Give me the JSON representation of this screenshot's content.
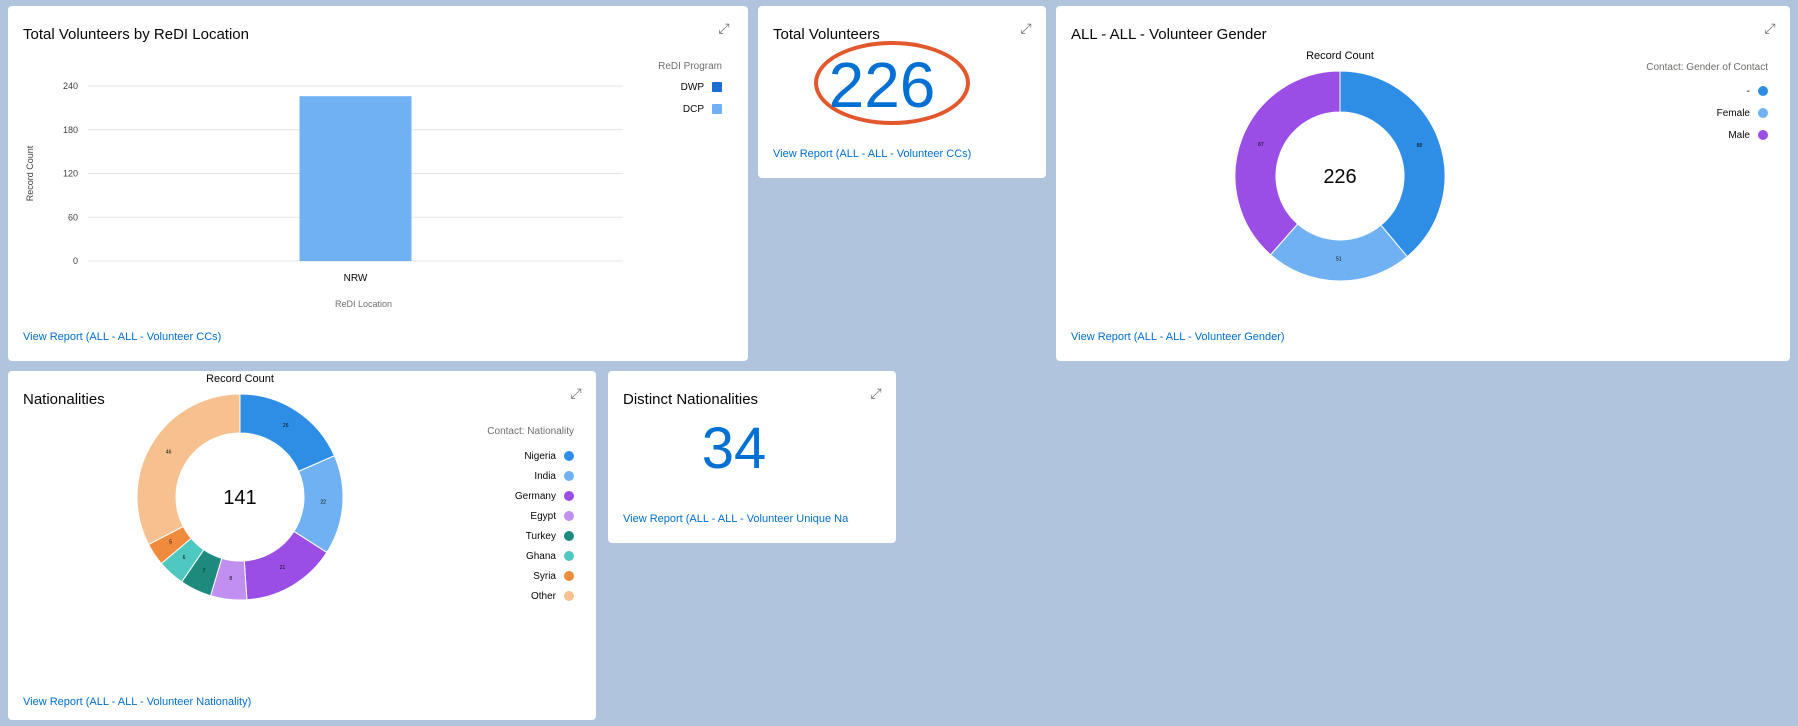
{
  "cards": {
    "by_location": {
      "title": "Total Volunteers by ReDI Location",
      "link": "View Report (ALL - ALL - Volunteer CCs)",
      "legend_title": "ReDI Program",
      "legend": [
        {
          "label": "DWP",
          "color": "#1b6fd1"
        },
        {
          "label": "DCP",
          "color": "#6fb1f3"
        }
      ]
    },
    "total": {
      "title": "Total Volunteers",
      "value": "226",
      "link": "View Report (ALL - ALL - Volunteer CCs)",
      "highlight_color": "#e2572b"
    },
    "gender": {
      "title": "ALL - ALL - Volunteer Gender",
      "link": "View Report (ALL - ALL - Volunteer Gender)",
      "legend_title": "Contact: Gender of Contact",
      "legend": [
        {
          "label": "-",
          "color": "#2e8ee6"
        },
        {
          "label": "Female",
          "color": "#6fb1f3"
        },
        {
          "label": "Male",
          "color": "#9b4ee6"
        }
      ]
    },
    "nationalities": {
      "title": "Nationalities",
      "link": "View Report (ALL - ALL - Volunteer Nationality)",
      "legend_title": "Contact: Nationality",
      "legend": [
        {
          "label": "Nigeria",
          "color": "#2e8ee6"
        },
        {
          "label": "India",
          "color": "#6fb1f3"
        },
        {
          "label": "Germany",
          "color": "#9b4ee6"
        },
        {
          "label": "Egypt",
          "color": "#c08ff0"
        },
        {
          "label": "Turkey",
          "color": "#1e8a7e"
        },
        {
          "label": "Ghana",
          "color": "#4ec8c0"
        },
        {
          "label": "Syria",
          "color": "#f08a3c"
        },
        {
          "label": "Other",
          "color": "#f6c08f"
        }
      ]
    },
    "distinct": {
      "title": "Distinct Nationalities",
      "value": "34",
      "link": "View Report (ALL - ALL - Volunteer Unique Na"
    }
  },
  "chart_data": [
    {
      "type": "bar",
      "title": "Total Volunteers by ReDI Location",
      "xlabel": "ReDI Location",
      "ylabel": "Record Count",
      "categories": [
        "NRW"
      ],
      "series": [
        {
          "name": "DWP",
          "values": [
            0
          ]
        },
        {
          "name": "DCP",
          "values": [
            226
          ]
        }
      ],
      "yticks": [
        "240",
        "180",
        "120",
        "60",
        "0"
      ],
      "ylim": [
        0,
        240
      ],
      "legend": "top-right"
    },
    {
      "type": "pie",
      "title": "Record Count",
      "center_label": "226",
      "slices": [
        {
          "label": "-",
          "value": 88,
          "color": "#2e8ee6"
        },
        {
          "label": "Female",
          "value": 51,
          "color": "#6fb1f3"
        },
        {
          "label": "Male",
          "value": 87,
          "color": "#9b4ee6"
        }
      ],
      "legend": "top-right"
    },
    {
      "type": "pie",
      "title": "Record Count",
      "center_label": "141",
      "slices": [
        {
          "label": "Nigeria",
          "value": 26,
          "color": "#2e8ee6"
        },
        {
          "label": "India",
          "value": 22,
          "color": "#6fb1f3"
        },
        {
          "label": "Germany",
          "value": 21,
          "color": "#9b4ee6"
        },
        {
          "label": "Egypt",
          "value": 8,
          "color": "#c08ff0"
        },
        {
          "label": "Turkey",
          "value": 7,
          "color": "#1e8a7e"
        },
        {
          "label": "Ghana",
          "value": 6,
          "color": "#4ec8c0"
        },
        {
          "label": "Syria",
          "value": 5,
          "color": "#f08a3c"
        },
        {
          "label": "Other",
          "value": 46,
          "color": "#f6c08f"
        }
      ],
      "legend": "top-right"
    }
  ]
}
